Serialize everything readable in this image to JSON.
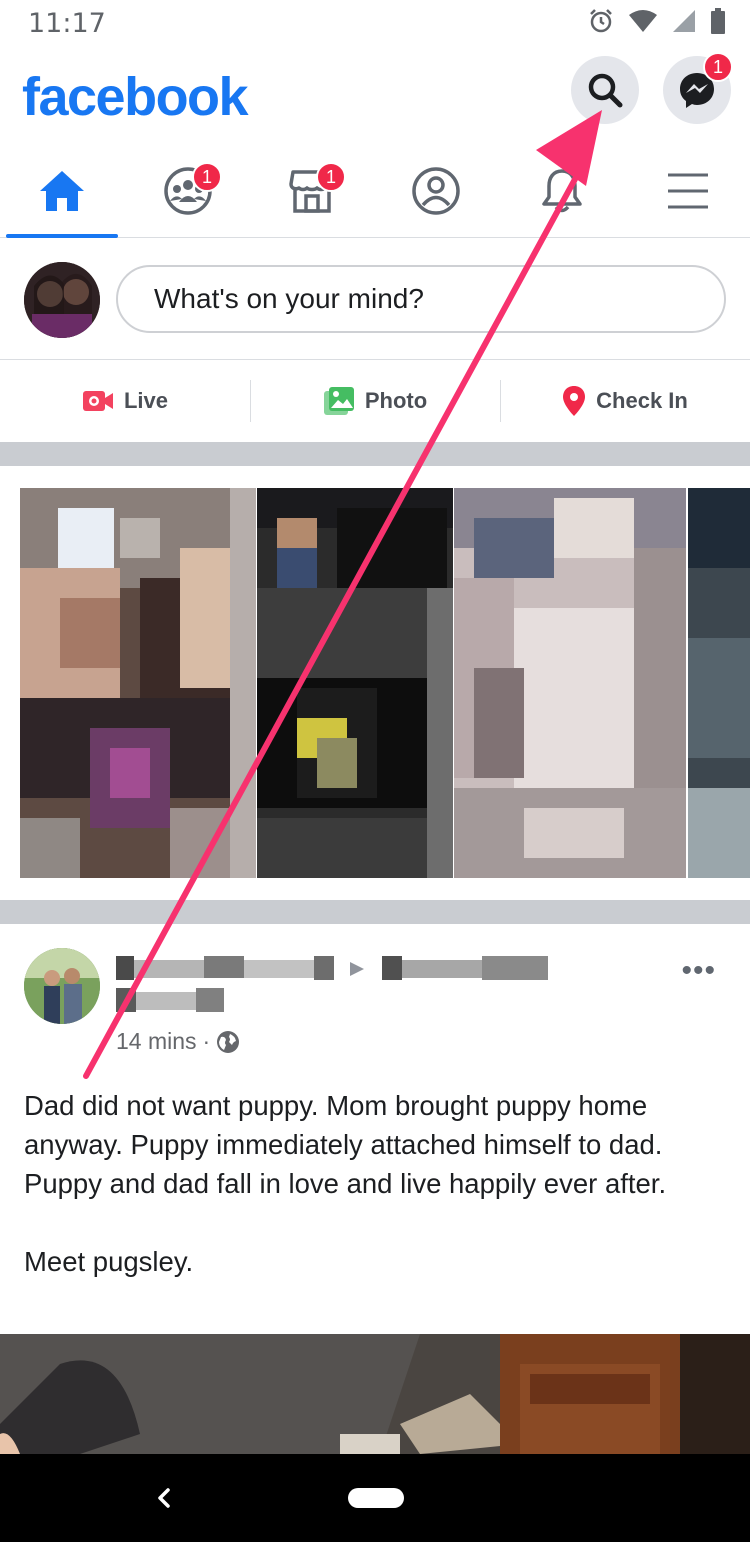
{
  "status_bar": {
    "time": "11:17",
    "icons": [
      "alarm-icon",
      "wifi-icon",
      "cell-signal-icon",
      "battery-icon"
    ]
  },
  "header": {
    "logo": "facebook",
    "search_icon": "search-icon",
    "messenger_icon": "messenger-icon",
    "messenger_badge": "1"
  },
  "nav_tabs": [
    {
      "name": "home",
      "icon": "home-icon",
      "active": true,
      "badge": ""
    },
    {
      "name": "groups",
      "icon": "groups-icon",
      "active": false,
      "badge": "1"
    },
    {
      "name": "marketplace",
      "icon": "marketplace-icon",
      "active": false,
      "badge": "1"
    },
    {
      "name": "profile",
      "icon": "profile-icon",
      "active": false,
      "badge": ""
    },
    {
      "name": "notifications",
      "icon": "bell-icon",
      "active": false,
      "badge": ""
    },
    {
      "name": "menu",
      "icon": "menu-icon",
      "active": false,
      "badge": ""
    }
  ],
  "composer": {
    "placeholder": "What's on your mind?"
  },
  "actions": [
    {
      "label": "Live",
      "icon": "live-video-icon",
      "color": "#f3425f"
    },
    {
      "label": "Photo",
      "icon": "photo-icon",
      "color": "#45bd62"
    },
    {
      "label": "Check In",
      "icon": "location-pin-icon",
      "color": "#f02849"
    }
  ],
  "post": {
    "timestamp": "14 mins",
    "separator": "·",
    "privacy_icon": "globe-icon",
    "more_label": "•••",
    "text": "Dad did not want puppy. Mom brought puppy home anyway. Puppy immediately attached himself to dad. Puppy and dad fall in love and live happily ever after.\n\nMeet pugsley."
  },
  "colors": {
    "brand": "#1877f2",
    "badge": "#f02849",
    "annotation_arrow": "#f7326e"
  }
}
